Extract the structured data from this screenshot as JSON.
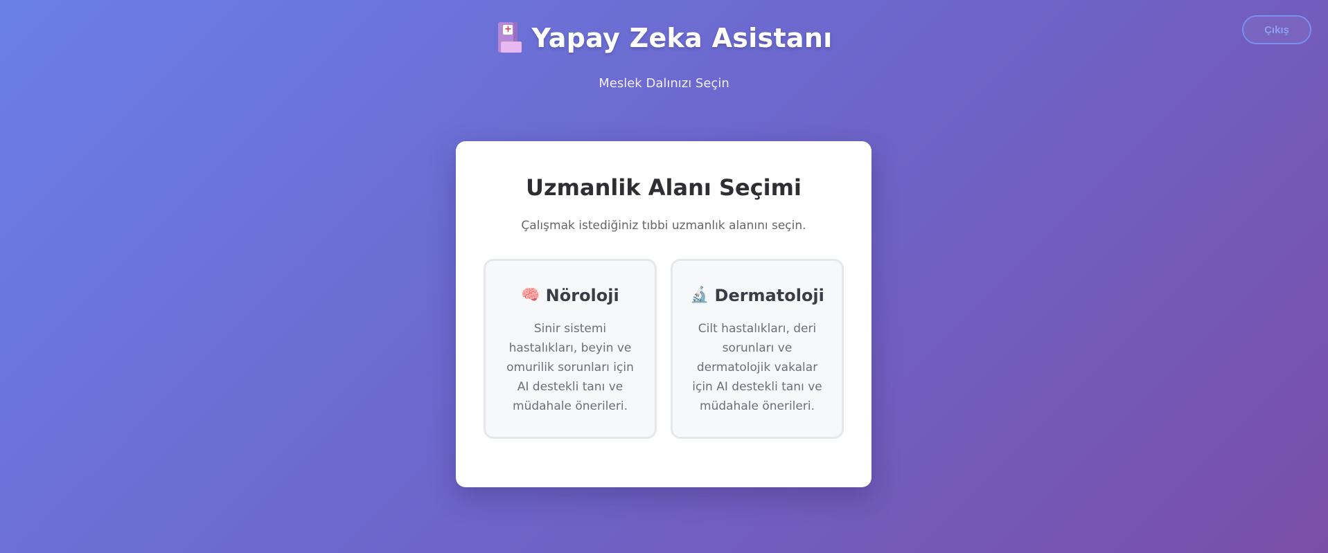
{
  "header": {
    "app_icon": "hospital-icon",
    "title": "Yapay Zeka Asistanı",
    "subtitle": "Meslek Dalınızı Seçin"
  },
  "actions": {
    "logout_label": "Çıkış"
  },
  "card": {
    "title": "Uzmanlik Alanı Seçimi",
    "description": "Çalışmak istediğiniz tıbbi uzmanlık alanını seçin.",
    "options": [
      {
        "icon": "brain-icon",
        "icon_glyph": "🧠",
        "label": "Nöroloji",
        "description": "Sinir sistemi hastalıkları, beyin ve omurilik sorunları için AI destekli tanı ve müdahale önerileri."
      },
      {
        "icon": "microscope-icon",
        "icon_glyph": "🔬",
        "label": "Dermatoloji",
        "description": "Cilt hastalıkları, deri sorunları ve dermatolojik vakalar için AI destekli tanı ve müdahale önerileri."
      }
    ]
  },
  "colors": {
    "background_start": "#6a7fe8",
    "background_end": "#7a4ea8",
    "card_background": "#ffffff",
    "option_background": "#f7f8fa",
    "logout_border": "#7a8ff0"
  }
}
